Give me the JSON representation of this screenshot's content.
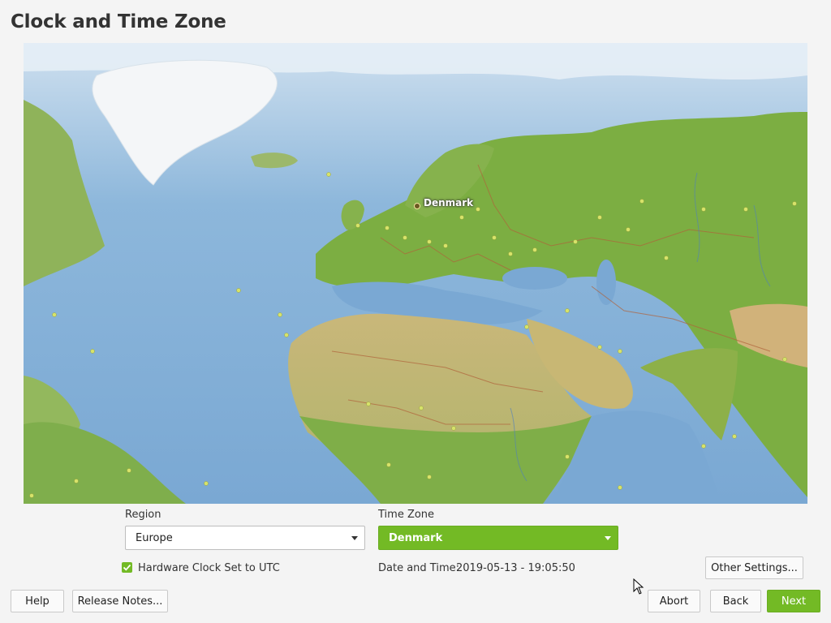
{
  "window": {
    "title": "Clock and Time Zone"
  },
  "map": {
    "selected_label": "Denmark"
  },
  "region": {
    "label": "Region",
    "value": "Europe"
  },
  "timezone": {
    "label": "Time Zone",
    "value": "Denmark"
  },
  "hardware_clock": {
    "label": "Hardware Clock Set to UTC",
    "checked": true
  },
  "datetime": {
    "label": "Date and Time:",
    "value": "2019-05-13 - 19:05:50"
  },
  "buttons": {
    "other_settings": "Other Settings...",
    "help": "Help",
    "release_notes": "Release Notes...",
    "abort": "Abort",
    "back": "Back",
    "next": "Next"
  },
  "colors": {
    "accent": "#73ba25",
    "ocean": "#8fb7d9",
    "land": "#8fb35a"
  }
}
